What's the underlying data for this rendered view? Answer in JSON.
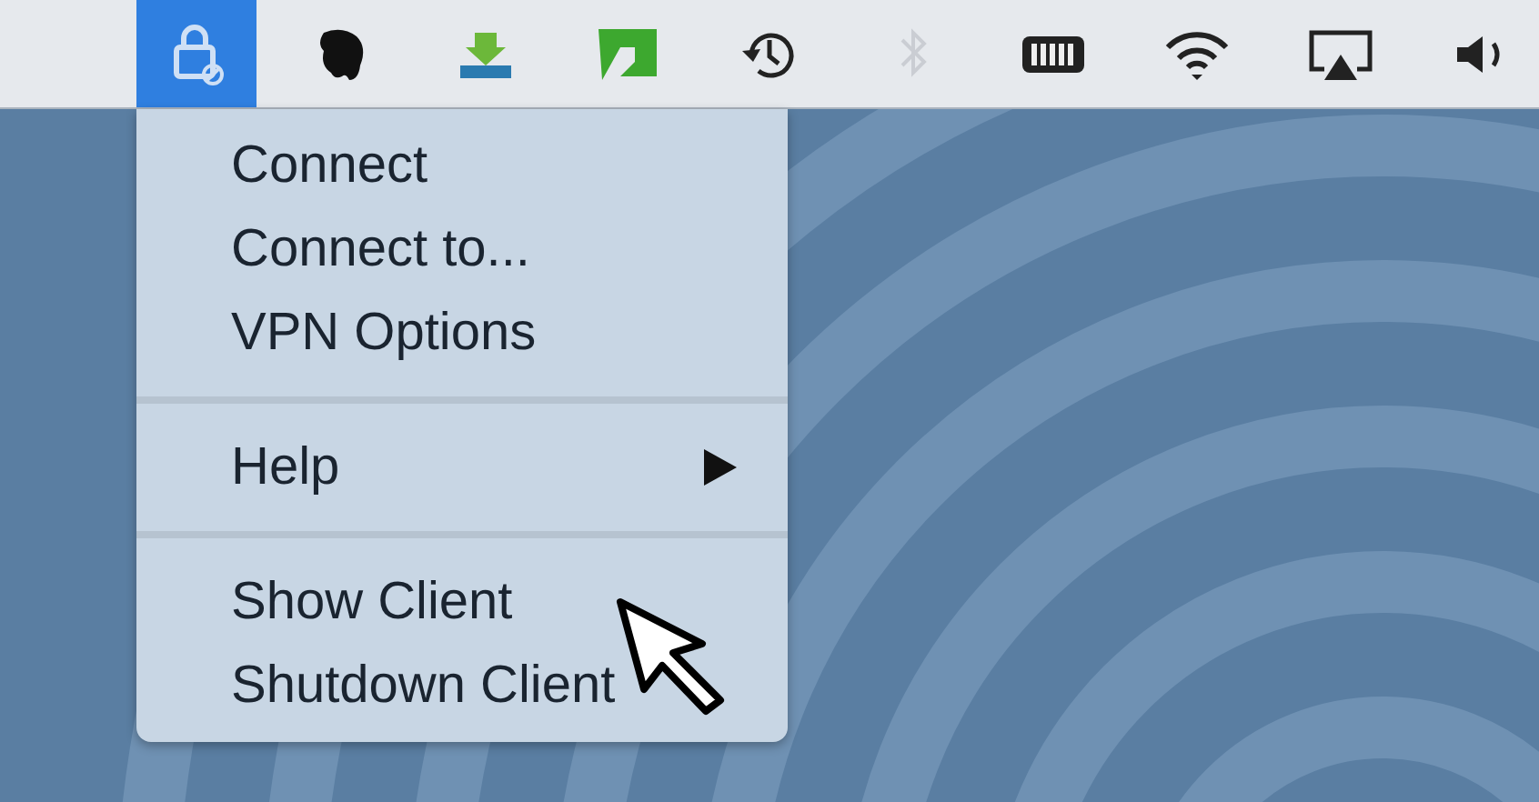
{
  "menu_bar": {
    "items": [
      {
        "selected": true
      },
      {
        "selected": false
      },
      {
        "selected": false
      },
      {
        "selected": false
      },
      {
        "selected": false
      },
      {
        "selected": false,
        "disabled": true
      },
      {
        "selected": false
      },
      {
        "selected": false
      },
      {
        "selected": false
      },
      {
        "selected": false
      }
    ]
  },
  "menu": {
    "groups": [
      {
        "items": [
          {
            "label": "Connect",
            "submenu": false
          },
          {
            "label": "Connect to...",
            "submenu": false
          },
          {
            "label": "VPN Options",
            "submenu": false
          }
        ]
      },
      {
        "items": [
          {
            "label": "Help",
            "submenu": true
          }
        ]
      },
      {
        "items": [
          {
            "label": "Show Client",
            "submenu": false
          },
          {
            "label": "Shutdown Client",
            "submenu": false
          }
        ]
      }
    ]
  }
}
